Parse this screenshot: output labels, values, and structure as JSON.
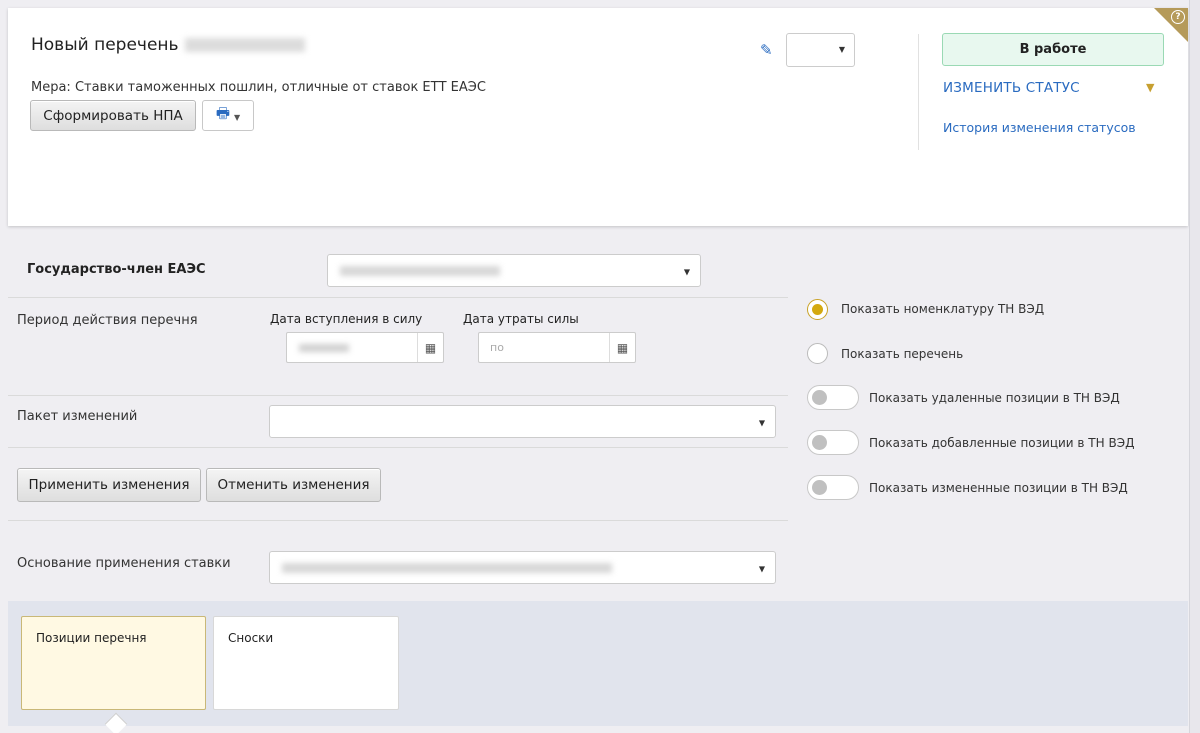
{
  "header": {
    "title": "Новый перечень",
    "measure": "Мера: Ставки таможенных пошлин, отличные от ставок ЕТТ ЕАЭС",
    "form_npa_button": "Сформировать НПА",
    "print_icon": "printer-icon",
    "status_label": "В работе",
    "change_status": "ИЗМЕНИТЬ СТАТУС",
    "status_history": "История изменения статусов",
    "help_icon": "help-icon"
  },
  "form": {
    "member_state_label": "Государство-член ЕАЭС",
    "period_label": "Период действия перечня",
    "date_start_label": "Дата вступления в силу",
    "date_end_label": "Дата утраты силы",
    "date_end_placeholder": "по",
    "package_label": "Пакет изменений",
    "apply_button": "Применить изменения",
    "cancel_button": "Отменить изменения",
    "basis_label": "Основание применения ставки"
  },
  "options": {
    "show_nomenclature": "Показать номенклатуру ТН ВЭД",
    "show_list": "Показать перечень",
    "show_deleted": "Показать удаленные позиции в ТН ВЭД",
    "show_added": "Показать добавленные позиции в ТН ВЭД",
    "show_changed": "Показать измененные позиции в ТН ВЭД"
  },
  "tabs": [
    {
      "label": "Позиции перечня",
      "active": true
    },
    {
      "label": "Сноски",
      "active": false
    }
  ],
  "colors": {
    "accent_blue": "#2a6bc0",
    "status_green_bg": "#e8f8ef",
    "radio_gold": "#d4a90f",
    "active_tab_bg": "#fff9e3"
  }
}
